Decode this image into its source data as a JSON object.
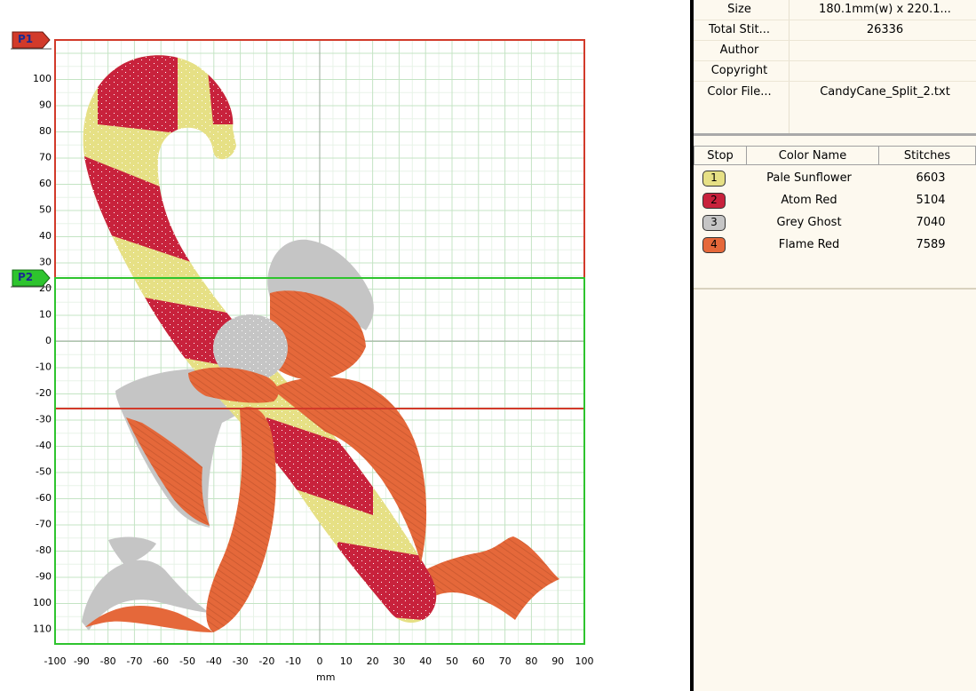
{
  "properties": [
    {
      "label": "Size",
      "value": "180.1mm(w) x 220.1..."
    },
    {
      "label": "Total Stit...",
      "value": "26336"
    },
    {
      "label": "Author",
      "value": ""
    },
    {
      "label": "Copyright",
      "value": ""
    },
    {
      "label": "Color File...",
      "value": "CandyCane_Split_2.txt"
    }
  ],
  "color_table": {
    "headers": {
      "stop": "Stop",
      "name": "Color Name",
      "stitches": "Stitches"
    },
    "rows": [
      {
        "stop": "1",
        "name": "Pale Sunflower",
        "stitches": "6603",
        "color": "#e6e085"
      },
      {
        "stop": "2",
        "name": "Atom Red",
        "stitches": "5104",
        "color": "#c8223c"
      },
      {
        "stop": "3",
        "name": "Grey Ghost",
        "stitches": "7040",
        "color": "#c5c5c5"
      },
      {
        "stop": "4",
        "name": "Flame Red",
        "stitches": "7589",
        "color": "#e5683a"
      }
    ]
  },
  "canvas": {
    "x_unit_label": "mm",
    "x_ticks": [
      "-100",
      "-90",
      "-80",
      "-70",
      "-60",
      "-50",
      "-40",
      "-30",
      "-20",
      "-10",
      "0",
      "10",
      "20",
      "30",
      "40",
      "50",
      "60",
      "70",
      "80",
      "90",
      "100"
    ],
    "y_ticks": [
      "100",
      "90",
      "80",
      "70",
      "60",
      "50",
      "40",
      "30",
      "20",
      "10",
      "0",
      "-10",
      "-20",
      "-30",
      "-40",
      "-50",
      "-60",
      "-70",
      "-80",
      "-90",
      "100",
      "110"
    ],
    "partitions": [
      {
        "label": "P1",
        "color": "#d23a2a"
      },
      {
        "label": "P2",
        "color": "#2ec42e"
      }
    ]
  },
  "colors": {
    "pale_sunflower": "#e6e085",
    "atom_red": "#c8223c",
    "grey_ghost": "#c5c5c5",
    "flame_red": "#e5683a",
    "p1_frame": "#d23a2a",
    "p2_frame": "#2ec42e",
    "grid_major": "#bfe3bf"
  }
}
